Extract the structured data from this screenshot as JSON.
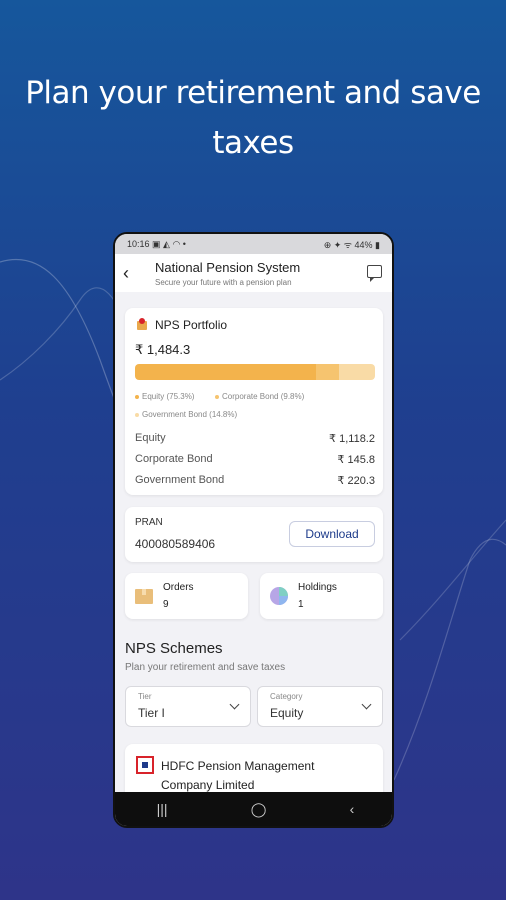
{
  "headline": "Plan your retirement and save taxes",
  "colors": {
    "accent": "#f3b34c",
    "accent_mid": "#f6c46f",
    "accent_light": "#f9dba6",
    "brand": "#1d3b8a",
    "bg_top": "#16579c",
    "bg_bottom": "#2e3489"
  },
  "statusbar": {
    "left": "10:16 ▣ ◭ ◠ •",
    "right": "⊕ ✦ ᯤ 44% ▮"
  },
  "appbar": {
    "title": "National Pension System",
    "subtitle": "Secure your future with a pension plan",
    "back_icon": "back-arrow-icon",
    "chat_icon": "chat-icon"
  },
  "portfolio": {
    "title": "NPS Portfolio",
    "total": "₹ 1,484.3",
    "allocation": [
      {
        "label": "Equity (75.3%)",
        "fraction": 0.753,
        "color": "#f3b34c"
      },
      {
        "label": "Corporate Bond (9.8%)",
        "fraction": 0.098,
        "color": "#f6c46f"
      },
      {
        "label": "Government Bond (14.8%)",
        "fraction": 0.148,
        "color": "#f9dba6"
      }
    ],
    "rows": [
      {
        "name": "Equity",
        "value": "₹ 1,118.2"
      },
      {
        "name": "Corporate Bond",
        "value": "₹ 145.8"
      },
      {
        "name": "Government Bond",
        "value": "₹ 220.3"
      }
    ]
  },
  "pran": {
    "label": "PRAN",
    "number": "400080589406",
    "download": "Download"
  },
  "orders": {
    "label": "Orders",
    "count": "9"
  },
  "holdings": {
    "label": "Holdings",
    "count": "1"
  },
  "schemes": {
    "title": "NPS Schemes",
    "subtitle": "Plan your retirement and save taxes"
  },
  "filters": {
    "tier": {
      "label": "Tier",
      "value": "Tier I"
    },
    "category": {
      "label": "Category",
      "value": "Equity"
    }
  },
  "fund": {
    "name": "HDFC Pension Management Company Limited"
  },
  "navbar": {
    "recents": "|||",
    "home": "◯",
    "back": "‹"
  }
}
